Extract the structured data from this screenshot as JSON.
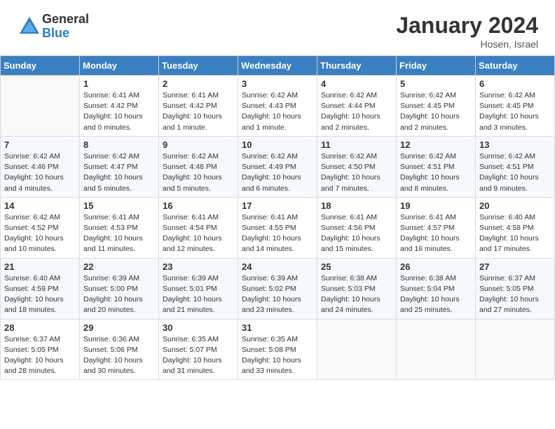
{
  "header": {
    "logo_general": "General",
    "logo_blue": "Blue",
    "month_title": "January 2024",
    "location": "Hosen, Israel"
  },
  "weekdays": [
    "Sunday",
    "Monday",
    "Tuesday",
    "Wednesday",
    "Thursday",
    "Friday",
    "Saturday"
  ],
  "weeks": [
    [
      {
        "day": "",
        "info": ""
      },
      {
        "day": "1",
        "info": "Sunrise: 6:41 AM\nSunset: 4:42 PM\nDaylight: 10 hours\nand 0 minutes."
      },
      {
        "day": "2",
        "info": "Sunrise: 6:41 AM\nSunset: 4:42 PM\nDaylight: 10 hours\nand 1 minute."
      },
      {
        "day": "3",
        "info": "Sunrise: 6:42 AM\nSunset: 4:43 PM\nDaylight: 10 hours\nand 1 minute."
      },
      {
        "day": "4",
        "info": "Sunrise: 6:42 AM\nSunset: 4:44 PM\nDaylight: 10 hours\nand 2 minutes."
      },
      {
        "day": "5",
        "info": "Sunrise: 6:42 AM\nSunset: 4:45 PM\nDaylight: 10 hours\nand 2 minutes."
      },
      {
        "day": "6",
        "info": "Sunrise: 6:42 AM\nSunset: 4:45 PM\nDaylight: 10 hours\nand 3 minutes."
      }
    ],
    [
      {
        "day": "7",
        "info": "Sunrise: 6:42 AM\nSunset: 4:46 PM\nDaylight: 10 hours\nand 4 minutes."
      },
      {
        "day": "8",
        "info": "Sunrise: 6:42 AM\nSunset: 4:47 PM\nDaylight: 10 hours\nand 5 minutes."
      },
      {
        "day": "9",
        "info": "Sunrise: 6:42 AM\nSunset: 4:48 PM\nDaylight: 10 hours\nand 5 minutes."
      },
      {
        "day": "10",
        "info": "Sunrise: 6:42 AM\nSunset: 4:49 PM\nDaylight: 10 hours\nand 6 minutes."
      },
      {
        "day": "11",
        "info": "Sunrise: 6:42 AM\nSunset: 4:50 PM\nDaylight: 10 hours\nand 7 minutes."
      },
      {
        "day": "12",
        "info": "Sunrise: 6:42 AM\nSunset: 4:51 PM\nDaylight: 10 hours\nand 8 minutes."
      },
      {
        "day": "13",
        "info": "Sunrise: 6:42 AM\nSunset: 4:51 PM\nDaylight: 10 hours\nand 9 minutes."
      }
    ],
    [
      {
        "day": "14",
        "info": "Sunrise: 6:42 AM\nSunset: 4:52 PM\nDaylight: 10 hours\nand 10 minutes."
      },
      {
        "day": "15",
        "info": "Sunrise: 6:41 AM\nSunset: 4:53 PM\nDaylight: 10 hours\nand 11 minutes."
      },
      {
        "day": "16",
        "info": "Sunrise: 6:41 AM\nSunset: 4:54 PM\nDaylight: 10 hours\nand 12 minutes."
      },
      {
        "day": "17",
        "info": "Sunrise: 6:41 AM\nSunset: 4:55 PM\nDaylight: 10 hours\nand 14 minutes."
      },
      {
        "day": "18",
        "info": "Sunrise: 6:41 AM\nSunset: 4:56 PM\nDaylight: 10 hours\nand 15 minutes."
      },
      {
        "day": "19",
        "info": "Sunrise: 6:41 AM\nSunset: 4:57 PM\nDaylight: 10 hours\nand 16 minutes."
      },
      {
        "day": "20",
        "info": "Sunrise: 6:40 AM\nSunset: 4:58 PM\nDaylight: 10 hours\nand 17 minutes."
      }
    ],
    [
      {
        "day": "21",
        "info": "Sunrise: 6:40 AM\nSunset: 4:59 PM\nDaylight: 10 hours\nand 18 minutes."
      },
      {
        "day": "22",
        "info": "Sunrise: 6:39 AM\nSunset: 5:00 PM\nDaylight: 10 hours\nand 20 minutes."
      },
      {
        "day": "23",
        "info": "Sunrise: 6:39 AM\nSunset: 5:01 PM\nDaylight: 10 hours\nand 21 minutes."
      },
      {
        "day": "24",
        "info": "Sunrise: 6:39 AM\nSunset: 5:02 PM\nDaylight: 10 hours\nand 23 minutes."
      },
      {
        "day": "25",
        "info": "Sunrise: 6:38 AM\nSunset: 5:03 PM\nDaylight: 10 hours\nand 24 minutes."
      },
      {
        "day": "26",
        "info": "Sunrise: 6:38 AM\nSunset: 5:04 PM\nDaylight: 10 hours\nand 25 minutes."
      },
      {
        "day": "27",
        "info": "Sunrise: 6:37 AM\nSunset: 5:05 PM\nDaylight: 10 hours\nand 27 minutes."
      }
    ],
    [
      {
        "day": "28",
        "info": "Sunrise: 6:37 AM\nSunset: 5:05 PM\nDaylight: 10 hours\nand 28 minutes."
      },
      {
        "day": "29",
        "info": "Sunrise: 6:36 AM\nSunset: 5:06 PM\nDaylight: 10 hours\nand 30 minutes."
      },
      {
        "day": "30",
        "info": "Sunrise: 6:35 AM\nSunset: 5:07 PM\nDaylight: 10 hours\nand 31 minutes."
      },
      {
        "day": "31",
        "info": "Sunrise: 6:35 AM\nSunset: 5:08 PM\nDaylight: 10 hours\nand 33 minutes."
      },
      {
        "day": "",
        "info": ""
      },
      {
        "day": "",
        "info": ""
      },
      {
        "day": "",
        "info": ""
      }
    ]
  ]
}
